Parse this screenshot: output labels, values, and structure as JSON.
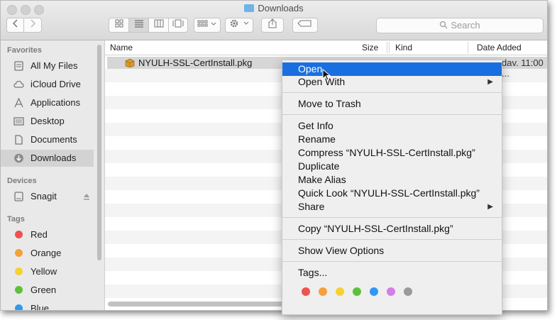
{
  "window": {
    "title": "Downloads"
  },
  "toolbar": {
    "search_placeholder": "Search"
  },
  "sidebar": {
    "favorites_header": "Favorites",
    "favorites": [
      {
        "label": "All My Files",
        "icon": "all-files-icon"
      },
      {
        "label": "iCloud Drive",
        "icon": "cloud-icon"
      },
      {
        "label": "Applications",
        "icon": "applications-icon"
      },
      {
        "label": "Desktop",
        "icon": "desktop-icon"
      },
      {
        "label": "Documents",
        "icon": "documents-icon"
      },
      {
        "label": "Downloads",
        "icon": "downloads-icon",
        "selected": true
      }
    ],
    "devices_header": "Devices",
    "devices": [
      {
        "label": "Snagit",
        "icon": "disk-icon"
      }
    ],
    "tags_header": "Tags",
    "tags": [
      {
        "label": "Red",
        "color": "#f0524f"
      },
      {
        "label": "Orange",
        "color": "#f5a03a"
      },
      {
        "label": "Yellow",
        "color": "#f5d233"
      },
      {
        "label": "Green",
        "color": "#5cc13d"
      },
      {
        "label": "Blue",
        "color": "#2f98f5"
      }
    ]
  },
  "columns": {
    "name": "Name",
    "size": "Size",
    "kind": "Kind",
    "date_added": "Date Added"
  },
  "files": [
    {
      "name": "NYULH-SSL-CertInstall.pkg",
      "date_added": "dav. 11:00 ..."
    }
  ],
  "context_menu": {
    "open": "Open",
    "open_with": "Open With",
    "move_to_trash": "Move to Trash",
    "get_info": "Get Info",
    "rename": "Rename",
    "compress": "Compress “NYULH-SSL-CertInstall.pkg”",
    "duplicate": "Duplicate",
    "make_alias": "Make Alias",
    "quick_look": "Quick Look “NYULH-SSL-CertInstall.pkg”",
    "share": "Share",
    "copy": "Copy “NYULH-SSL-CertInstall.pkg”",
    "show_view_options": "Show View Options",
    "tags": "Tags...",
    "tag_colors": [
      "#f0524f",
      "#f5a03a",
      "#f5d233",
      "#5cc13d",
      "#2f98f5",
      "#d27ee6",
      "#9a9a9a"
    ]
  },
  "accent_color": "#1a6fe0"
}
